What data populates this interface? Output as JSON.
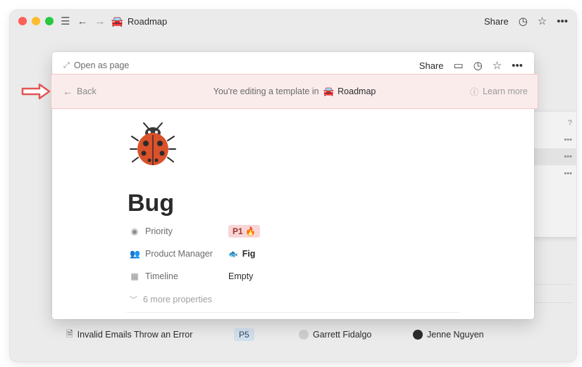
{
  "titlebar": {
    "page_emoji": "🚘",
    "page_title": "Roadmap",
    "share_label": "Share",
    "icons": [
      "hamburger-icon",
      "back-arrow-icon",
      "forward-arrow-icon",
      "clock-icon",
      "star-icon",
      "more-icon"
    ]
  },
  "modal": {
    "open_as_page": "Open as page",
    "share_label": "Share",
    "banner": {
      "back_label": "Back",
      "editing_text": "You're editing a template in",
      "page_emoji": "🚘",
      "page_name": "Roadmap",
      "learn_more": "Learn more"
    },
    "page": {
      "title": "Bug",
      "properties": [
        {
          "label": "Priority",
          "value": "P1 🔥"
        },
        {
          "label": "Product Manager",
          "value": "Fig",
          "value_icon": "🐟"
        },
        {
          "label": "Timeline",
          "value": "Empty"
        }
      ],
      "more_properties": "6 more properties"
    }
  },
  "background_row": {
    "name": "Invalid Emails Throw an Error",
    "priority": "P5",
    "person1": "Garrett Fidalgo",
    "person2": "Jenne Nguyen"
  },
  "colors": {
    "banner_bg": "#fbecec",
    "banner_border": "#f3c4c4",
    "arrow": "#e05555",
    "p1_bg": "#f8d6d6",
    "p5_bg": "#d3e0ee"
  }
}
